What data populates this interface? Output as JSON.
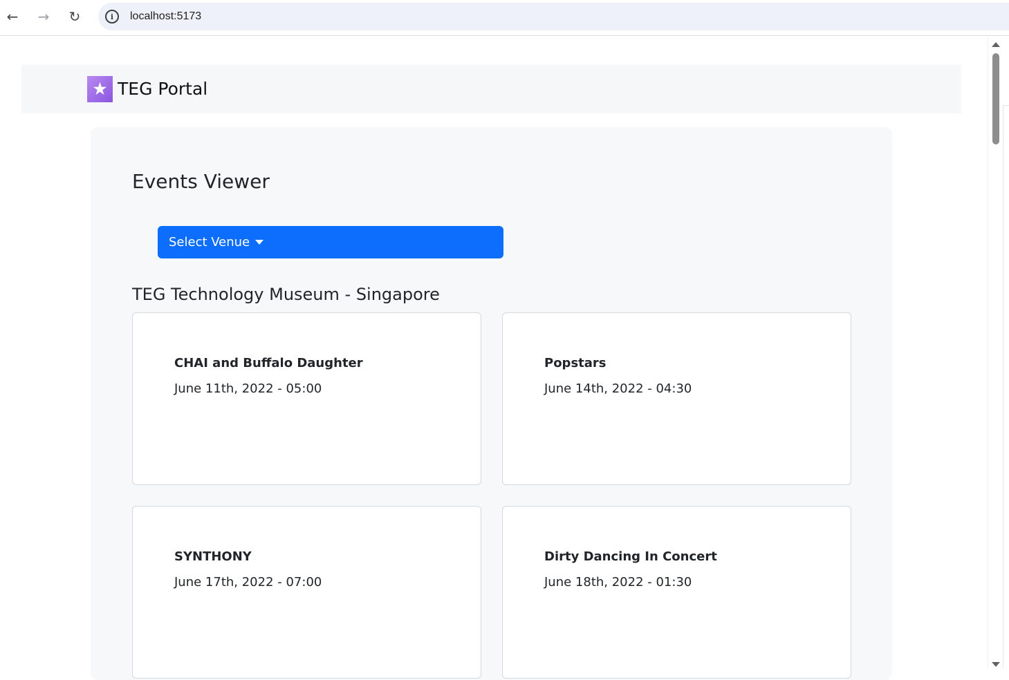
{
  "browser": {
    "url": "localhost:5173"
  },
  "navbar": {
    "brand_icon": "star-ticket-icon",
    "brand_name": "TEG Portal"
  },
  "page": {
    "title": "Events Viewer",
    "select_venue_label": "Select Venue",
    "venue_name": "TEG Technology Museum - Singapore"
  },
  "events": [
    {
      "name": "CHAI and Buffalo Daughter",
      "date": "June 11th, 2022 - 05:00"
    },
    {
      "name": "Popstars",
      "date": "June 14th, 2022 - 04:30"
    },
    {
      "name": "SYNTHONY",
      "date": "June 17th, 2022 - 07:00"
    },
    {
      "name": "Dirty Dancing In Concert",
      "date": "June 18th, 2022 - 01:30"
    }
  ],
  "colors": {
    "primary": "#0d6efd",
    "brand_purple": "#9b6be8"
  }
}
